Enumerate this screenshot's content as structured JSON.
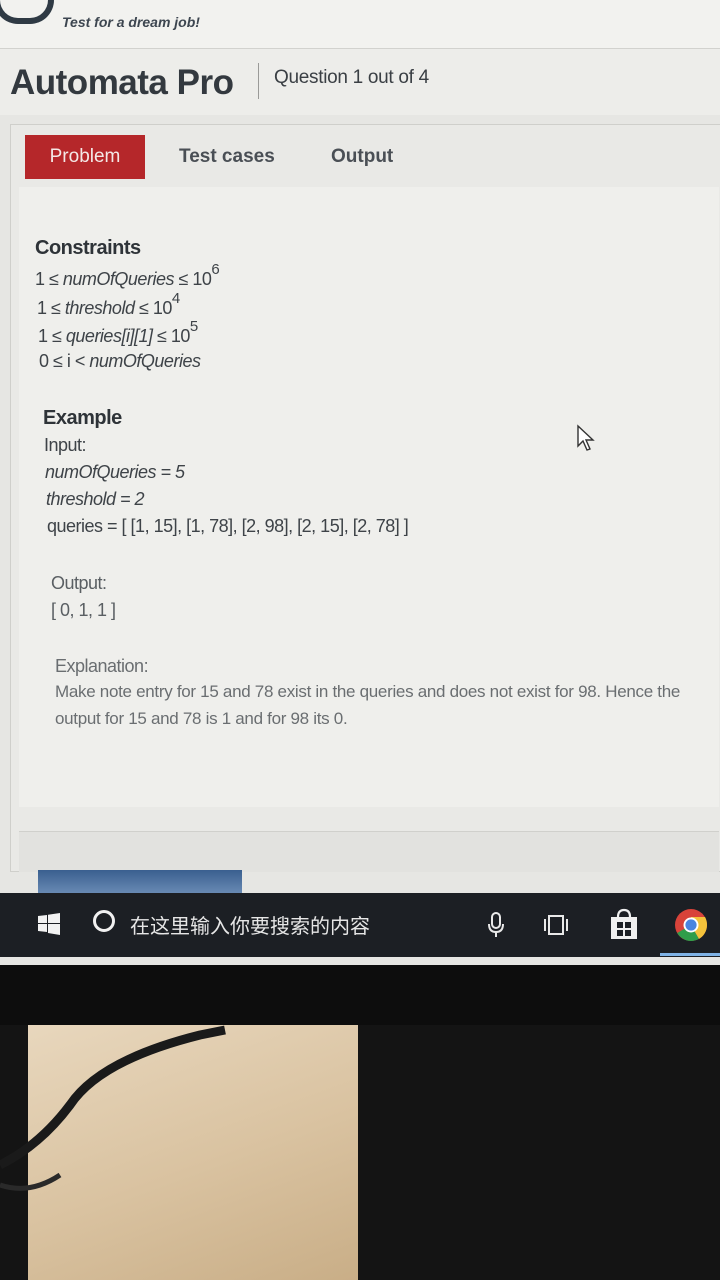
{
  "brand": {
    "tagline": "Test for a dream job!"
  },
  "header": {
    "app_title": "Automata Pro",
    "question_counter": "Question 1 out of 4"
  },
  "tabs": [
    {
      "label": "Problem",
      "active": true
    },
    {
      "label": "Test cases",
      "active": false
    },
    {
      "label": "Output",
      "active": false
    }
  ],
  "constraints": {
    "heading": "Constraints",
    "lines": [
      {
        "prefix": "1 ≤ ",
        "var": "numOfQueries",
        "suffix": " ≤ 10",
        "exp": "6"
      },
      {
        "prefix": "1 ≤ ",
        "var": "threshold",
        "suffix": " ≤ 10",
        "exp": "4"
      },
      {
        "prefix": "1 ≤ ",
        "var": "queries[i][1]",
        "suffix": " ≤ 10",
        "exp": "5"
      },
      {
        "prefix": "0 ≤ i < ",
        "var": "numOfQueries",
        "suffix": "",
        "exp": ""
      }
    ]
  },
  "example": {
    "heading": "Example",
    "input_label": "Input:",
    "num_of_queries_line": "numOfQueries = 5",
    "threshold_line": "threshold = 2",
    "queries_line": "queries = [ [1, 15], [1, 78], [2, 98], [2, 15], [2, 78] ]",
    "output_label": "Output:",
    "output_value": "[ 0, 1, 1 ]",
    "explanation_label": "Explanation:",
    "explanation_text": "Make note entry for 15 and 78 exist in the queries and does not exist for 98. Hence the output for 15 and 78 is 1 and for 98 its 0."
  },
  "taskbar": {
    "search_placeholder": "在这里输入你要搜索的内容",
    "icons": [
      "windows-icon",
      "cortana-icon",
      "mic-icon",
      "task-view-icon",
      "store-icon",
      "chrome-icon"
    ]
  },
  "colors": {
    "active_tab": "#b5272a",
    "taskbar": "#1c1f24",
    "panel": "#efefec"
  }
}
